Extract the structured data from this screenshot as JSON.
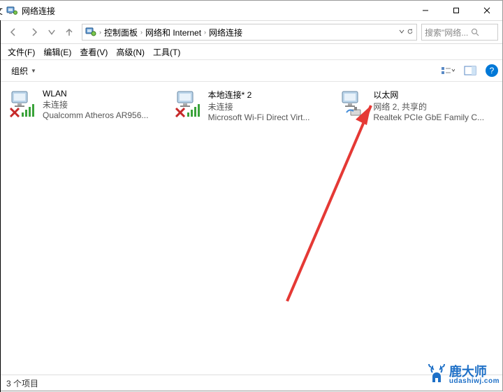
{
  "window": {
    "title": "网络连接"
  },
  "breadcrumbs": {
    "root": "控制面板",
    "mid": "网络和 Internet",
    "leaf": "网络连接"
  },
  "search": {
    "placeholder": "搜索\"网络..."
  },
  "menu": {
    "file": "文件(F)",
    "edit": "编辑(E)",
    "view": "查看(V)",
    "advanced": "高级(N)",
    "tools": "工具(T)"
  },
  "toolbar": {
    "organize": "组织"
  },
  "connections": [
    {
      "name": "WLAN",
      "status": "未连接",
      "desc": "Qualcomm Atheros AR956...",
      "disabled": true
    },
    {
      "name": "本地连接* 2",
      "status": "未连接",
      "desc": "Microsoft Wi-Fi Direct Virt...",
      "disabled": true
    },
    {
      "name": "以太网",
      "status": "网络 2, 共享的",
      "desc": "Realtek PCIe GbE Family C...",
      "disabled": false
    }
  ],
  "statusbar": {
    "items": "3 个项目"
  },
  "watermark": {
    "name": "鹿大师",
    "url": "udashiwj.com"
  }
}
